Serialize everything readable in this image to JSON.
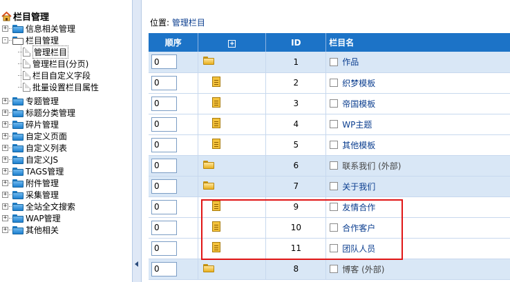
{
  "tree": {
    "title": "栏目管理",
    "nodes": [
      {
        "label": "信息相关管理",
        "toggle": "+"
      },
      {
        "label": "栏目管理",
        "toggle": "-"
      },
      {
        "label": "专题管理",
        "toggle": "+"
      },
      {
        "label": "标题分类管理",
        "toggle": "+"
      },
      {
        "label": "碎片管理",
        "toggle": "+"
      },
      {
        "label": "自定义页面",
        "toggle": "+"
      },
      {
        "label": "自定义列表",
        "toggle": "+"
      },
      {
        "label": "自定义JS",
        "toggle": "+"
      },
      {
        "label": "TAGS管理",
        "toggle": "+"
      },
      {
        "label": "附件管理",
        "toggle": "+"
      },
      {
        "label": "采集管理",
        "toggle": "+"
      },
      {
        "label": "全站全文搜索",
        "toggle": "+"
      },
      {
        "label": "WAP管理",
        "toggle": "+"
      },
      {
        "label": "其他相关",
        "toggle": "+"
      }
    ],
    "children": [
      "管理栏目",
      "管理栏目(分页)",
      "栏目自定义字段",
      "批量设置栏目属性"
    ]
  },
  "location": {
    "prefix": "位置: ",
    "link": "管理栏目"
  },
  "grid": {
    "headers": {
      "order": "顺序",
      "expand": "+",
      "id": "ID",
      "name": "栏目名"
    },
    "rows": [
      {
        "order": "0",
        "id": "1",
        "name": "作品",
        "kind": "folder",
        "level": "top"
      },
      {
        "order": "0",
        "id": "2",
        "name": "织梦模板",
        "kind": "doc",
        "level": "sub"
      },
      {
        "order": "0",
        "id": "3",
        "name": "帝国模板",
        "kind": "doc",
        "level": "sub"
      },
      {
        "order": "0",
        "id": "4",
        "name": "WP主题",
        "kind": "doc",
        "level": "sub"
      },
      {
        "order": "0",
        "id": "5",
        "name": "其他模板",
        "kind": "doc",
        "level": "sub"
      },
      {
        "order": "0",
        "id": "6",
        "name": "联系我们 (外部)",
        "kind": "folder",
        "level": "top",
        "gray": true
      },
      {
        "order": "0",
        "id": "7",
        "name": "关于我们",
        "kind": "folder",
        "level": "top"
      },
      {
        "order": "0",
        "id": "9",
        "name": "友情合作",
        "kind": "doc",
        "level": "sub"
      },
      {
        "order": "0",
        "id": "10",
        "name": "合作客户",
        "kind": "doc",
        "level": "sub"
      },
      {
        "order": "0",
        "id": "11",
        "name": "团队人员",
        "kind": "doc",
        "level": "sub"
      },
      {
        "order": "0",
        "id": "8",
        "name": "博客 (外部)",
        "kind": "folder",
        "level": "top",
        "gray": true
      }
    ]
  },
  "colors": {
    "header": "#1c73c7",
    "top_row": "#d9e7f6",
    "highlight": "#e01414",
    "link": "#0a3d8f"
  }
}
